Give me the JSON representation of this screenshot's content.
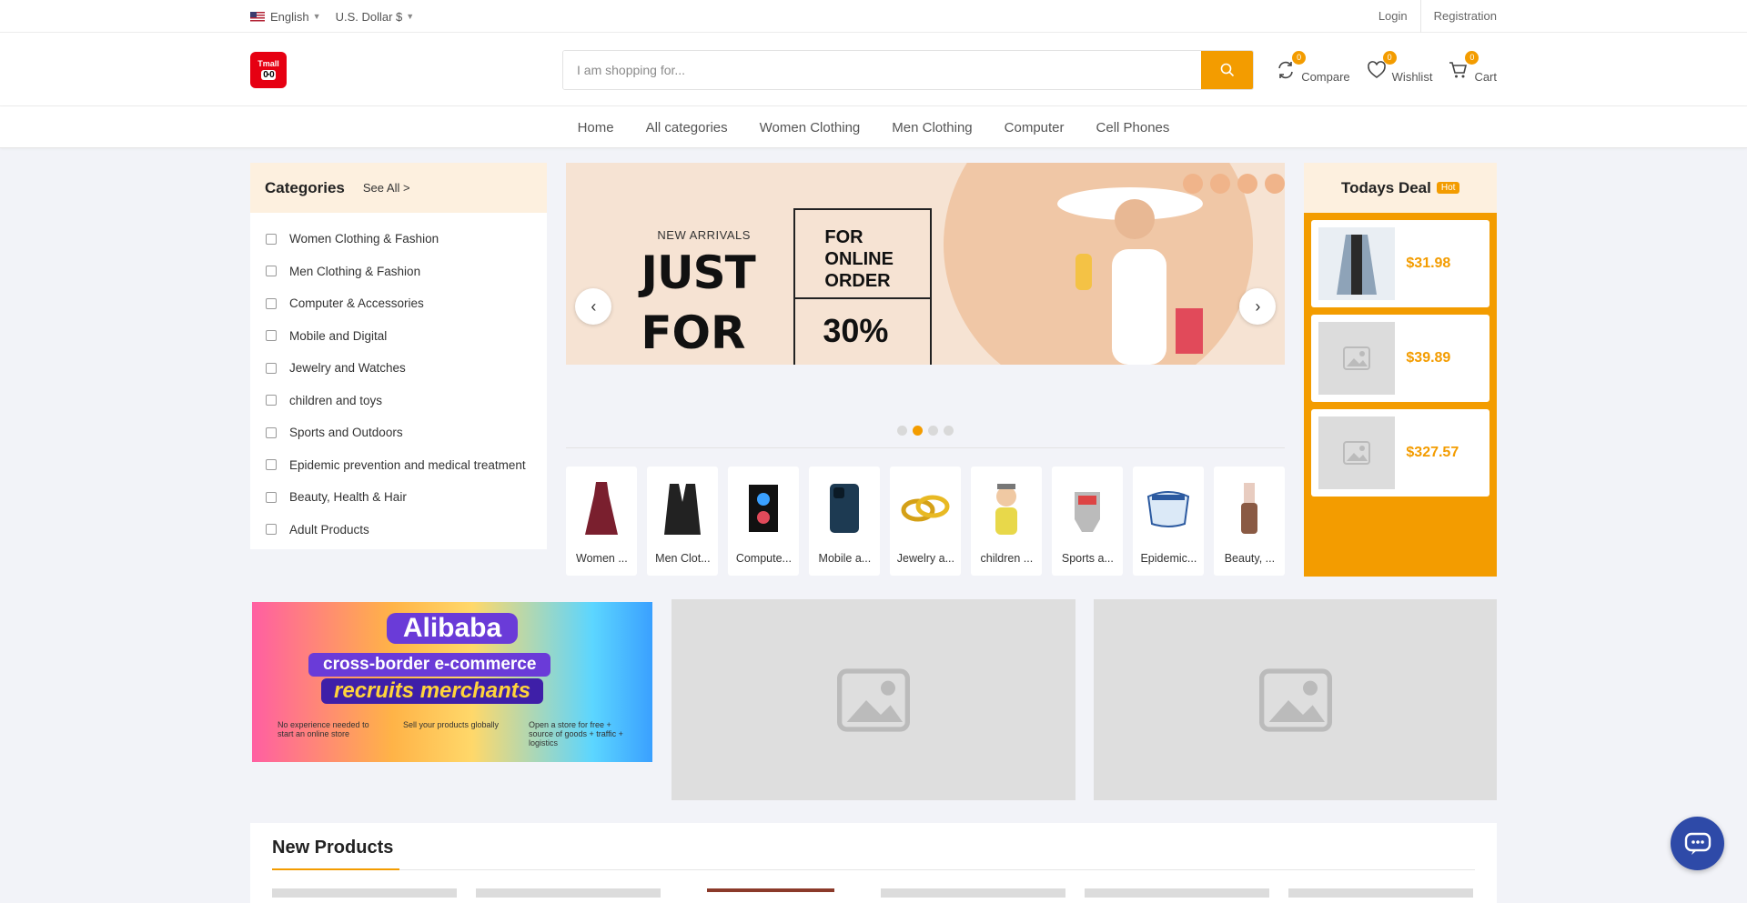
{
  "topbar": {
    "language": "English",
    "currency": "U.S. Dollar $",
    "login": "Login",
    "registration": "Registration"
  },
  "header": {
    "logo_text": "Tmall",
    "logo_face": "0·0",
    "search_placeholder": "I am shopping for...",
    "compare": {
      "label": "Compare",
      "count": "0"
    },
    "wishlist": {
      "label": "Wishlist",
      "count": "0"
    },
    "cart": {
      "label": "Cart",
      "count": "0"
    }
  },
  "nav": [
    "Home",
    "All categories",
    "Women Clothing",
    "Men Clothing",
    "Computer",
    "Cell Phones"
  ],
  "categories": {
    "title": "Categories",
    "see_all": "See All >",
    "items": [
      "Women Clothing & Fashion",
      "Men Clothing & Fashion",
      "Computer & Accessories",
      "Mobile and Digital",
      "Jewelry and Watches",
      "children and toys",
      "Sports and Outdoors",
      "Epidemic prevention and medical treatment",
      "Beauty, Health & Hair",
      "Adult Products"
    ]
  },
  "slider": {
    "line1": "NEW ARRIVALS",
    "line2": "JUST",
    "line3": "FOR",
    "box_top": "FOR ONLINE ORDER",
    "box_bottom": "30%",
    "active_dot": 2,
    "dot_count": 4
  },
  "thumbs": [
    "Women ...",
    "Men Clot...",
    "Compute...",
    "Mobile a...",
    "Jewelry a...",
    "children ...",
    "Sports a...",
    "Epidemic...",
    "Beauty, ..."
  ],
  "deal": {
    "title": "Todays Deal",
    "badge": "Hot",
    "items": [
      {
        "price": "$31.98"
      },
      {
        "price": "$39.89"
      },
      {
        "price": "$327.57"
      }
    ]
  },
  "promo": {
    "title": "Alibaba",
    "subtitle": "cross-border e-commerce",
    "tagline": "recruits merchants",
    "notes": [
      "No experience needed to start an online store",
      "Sell your products globally",
      "Open a store for free + source of goods + traffic + logistics"
    ]
  },
  "new_products": {
    "title": "New Products"
  },
  "colors": {
    "accent": "#f39c00",
    "chat": "#2e4aa8",
    "brand_red": "#e60012"
  }
}
